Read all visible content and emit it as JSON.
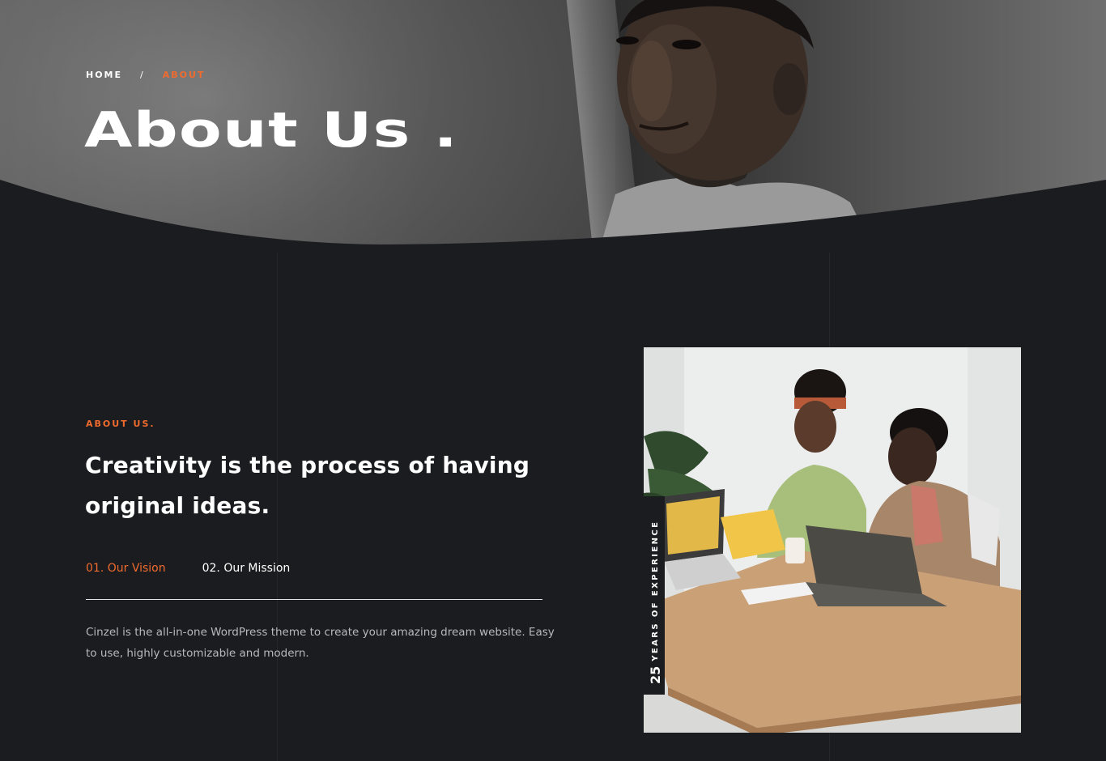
{
  "hero": {
    "breadcrumb": {
      "home": "HOME",
      "separator": "/",
      "current": "ABOUT"
    },
    "title": "About Us ."
  },
  "about": {
    "eyebrow": "ABOUT US.",
    "headline": "Creativity is the process of having original ideas.",
    "tabs": [
      {
        "label": "01. Our Vision",
        "active": true
      },
      {
        "label": "02. Our Mission",
        "active": false
      }
    ],
    "description": "Cinzel is the all-in-one WordPress theme to create your amazing dream website. Easy to use, highly customizable and modern.",
    "experience": {
      "number": "25",
      "label": "YEARS OF EXPERIENCE"
    }
  },
  "colors": {
    "background": "#1b1c1f",
    "accent": "#f06b2e",
    "text": "#ffffff",
    "muted_text": "#b9b9bd"
  }
}
